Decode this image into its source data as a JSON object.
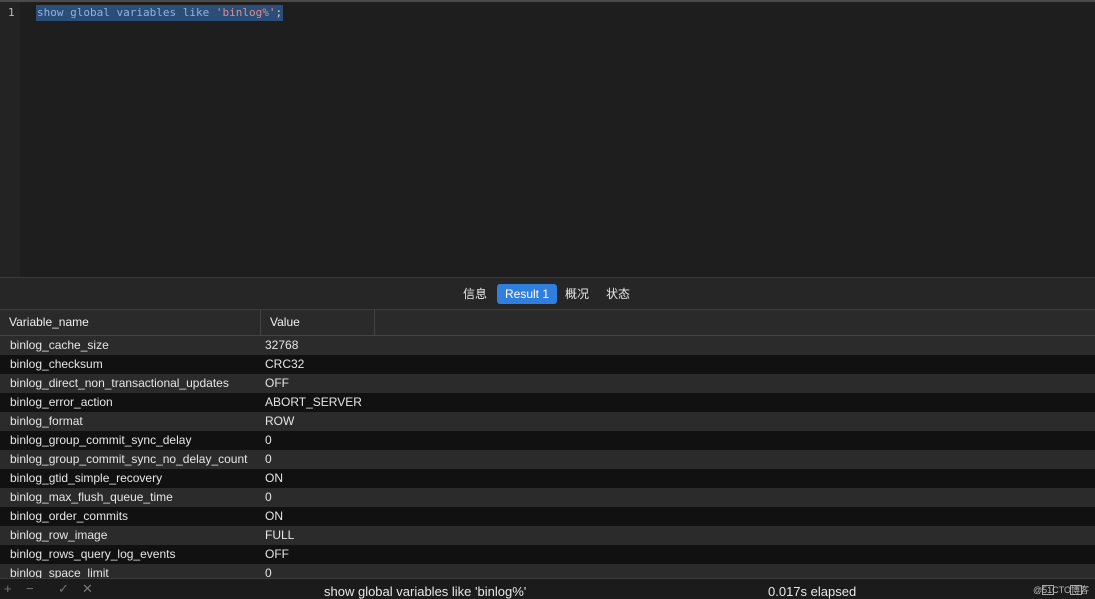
{
  "editor": {
    "line_number": "1",
    "code": {
      "kw1": "show",
      "kw2": "global",
      "kw3": "variables",
      "kw4": "like",
      "str": "'binlog%'",
      "end": ";"
    }
  },
  "tabs": [
    {
      "label": "信息"
    },
    {
      "label": "Result 1"
    },
    {
      "label": "概况"
    },
    {
      "label": "状态"
    }
  ],
  "table": {
    "headers": [
      "Variable_name",
      "Value"
    ],
    "rows": [
      [
        "binlog_cache_size",
        "32768"
      ],
      [
        "binlog_checksum",
        "CRC32"
      ],
      [
        "binlog_direct_non_transactional_updates",
        "OFF"
      ],
      [
        "binlog_error_action",
        "ABORT_SERVER"
      ],
      [
        "binlog_format",
        "ROW"
      ],
      [
        "binlog_group_commit_sync_delay",
        "0"
      ],
      [
        "binlog_group_commit_sync_no_delay_count",
        "0"
      ],
      [
        "binlog_gtid_simple_recovery",
        "ON"
      ],
      [
        "binlog_max_flush_queue_time",
        "0"
      ],
      [
        "binlog_order_commits",
        "ON"
      ],
      [
        "binlog_row_image",
        "FULL"
      ],
      [
        "binlog_rows_query_log_events",
        "OFF"
      ],
      [
        "binlog_space_limit",
        "0"
      ]
    ]
  },
  "status": {
    "query": "show global variables like 'binlog%'",
    "elapsed": "0.017s elapsed",
    "watermark": "@51CTO博客"
  },
  "colors": {
    "accent": "#2f7fde",
    "selection": "#2a4e78"
  }
}
